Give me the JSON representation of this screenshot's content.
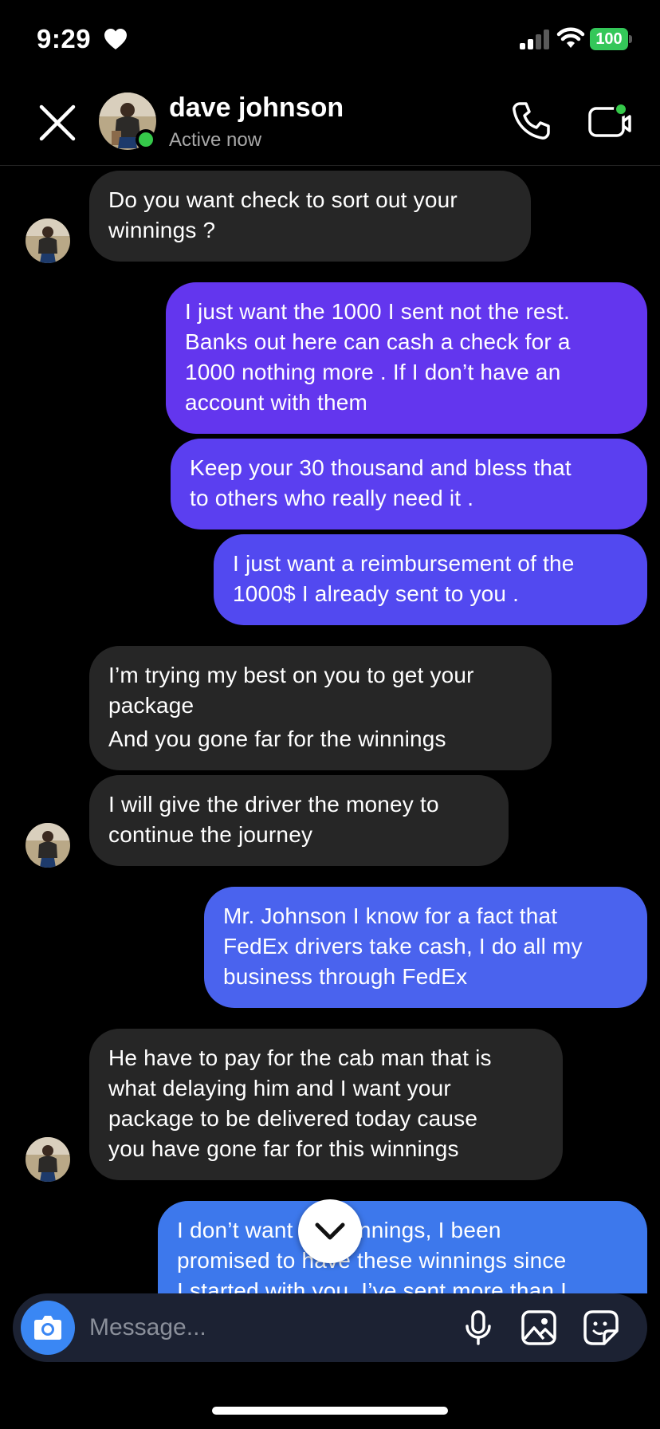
{
  "status_bar": {
    "time": "9:29",
    "battery": "100"
  },
  "header": {
    "name": "dave johnson",
    "status": "Active now"
  },
  "messages": [
    {
      "from": "them",
      "lines": [
        "Do you want check to sort out your",
        "winnings ?"
      ]
    },
    {
      "from": "me",
      "lines": [
        "I just want the 1000 I sent not the rest.",
        "Banks out here can cash a check for a",
        "1000 nothing more . If I don’t have an",
        "account with them"
      ]
    },
    {
      "from": "me",
      "lines": [
        "Keep your 30 thousand and bless that",
        "to others who really need it ."
      ]
    },
    {
      "from": "me",
      "lines": [
        "I just want a reimbursement of the",
        "1000$ I already sent to you ."
      ]
    },
    {
      "from": "them",
      "lines": [
        "I’m trying my best on you to get your",
        "package",
        "And you gone far for the winnings"
      ]
    },
    {
      "from": "them",
      "lines": [
        "I will give the driver the money to",
        "continue the journey"
      ]
    },
    {
      "from": "me",
      "lines": [
        "Mr. Johnson I know for a fact that",
        "FedEx drivers take cash, I do all my",
        "business through FedEx"
      ]
    },
    {
      "from": "them",
      "lines": [
        "He have to pay for the cab man that is",
        "what delaying him and I want your",
        "package to be delivered today cause",
        "you have gone far for this winnings"
      ]
    },
    {
      "from": "me",
      "lines": [
        "I don’t want the winnings, I been",
        "promised to have these winnings since",
        "I started with you. I’ve sent more than I"
      ]
    }
  ],
  "composer": {
    "placeholder": "Message..."
  },
  "colors": {
    "incoming": "#262626",
    "outgoing_1": "#6336ee",
    "outgoing_2": "#5b3ff0",
    "outgoing_3": "#5249f0",
    "outgoing_4": "#4a63ee",
    "outgoing_5": "#3d78ec",
    "online": "#35c94a",
    "camera": "#3a87f4"
  },
  "icons": [
    "heart-icon",
    "signal-icon",
    "wifi-icon",
    "battery-icon",
    "close-icon",
    "phone-icon",
    "video-call-icon",
    "camera-icon",
    "microphone-icon",
    "gallery-icon",
    "sticker-icon",
    "chevron-down-icon"
  ]
}
